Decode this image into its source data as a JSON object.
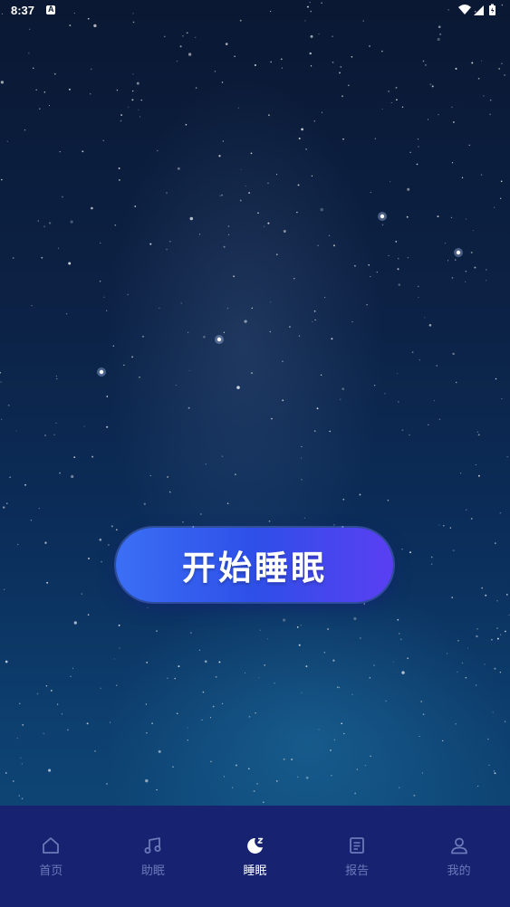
{
  "status_bar": {
    "time": "8:37",
    "notification_icon": "accessibility-a-icon",
    "icons": [
      "wifi-icon",
      "signal-icon",
      "battery-icon"
    ]
  },
  "main": {
    "start_button_label": "开始睡眠",
    "background": "starry-night-sky-image"
  },
  "tab_bar": {
    "background_color": "#172371",
    "active_color": "#ffffff",
    "inactive_color": "#6c79b8",
    "tabs": [
      {
        "label": "首页",
        "icon": "home-icon"
      },
      {
        "label": "助眠",
        "icon": "music-note-icon"
      },
      {
        "label": "睡眠",
        "icon": "moon-sleep-icon",
        "active": true
      },
      {
        "label": "报告",
        "icon": "report-document-icon"
      },
      {
        "label": "我的",
        "icon": "profile-person-icon"
      }
    ]
  }
}
